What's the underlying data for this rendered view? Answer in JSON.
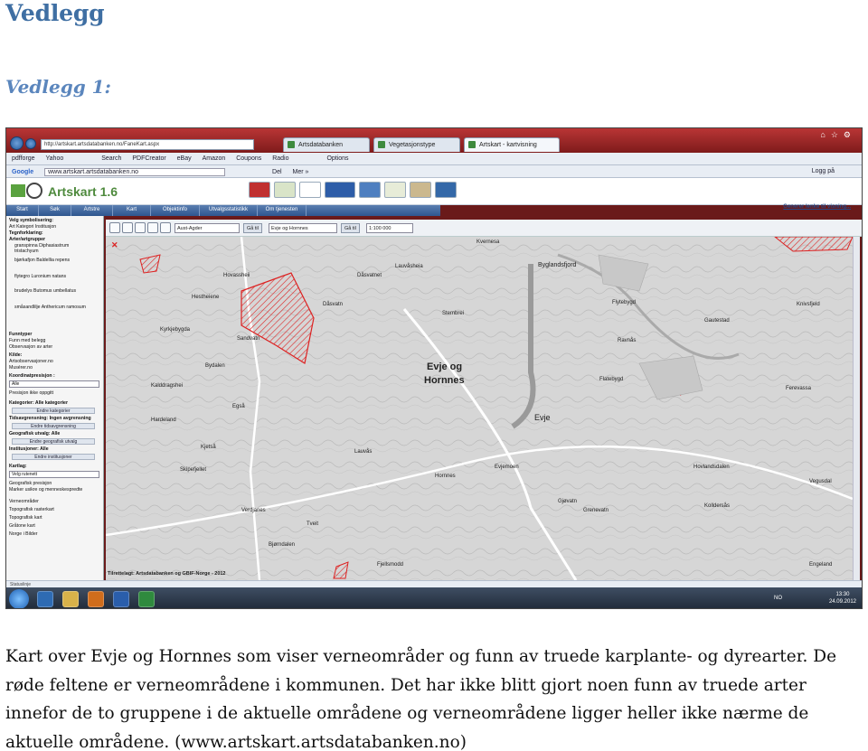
{
  "document": {
    "title": "Vedlegg",
    "subtitle": "Vedlegg 1:",
    "caption_lines": [
      "Kart over Evje og Hornnes som viser verneområder og funn av truede karplante- og dyrearter. De",
      "røde feltene er verneområdene i kommunen. Det har ikke blitt gjort noen funn av truede arter",
      "innefor de to gruppene i de aktuelle områdene og verneområdene ligger heller ikke nærme de",
      "aktuelle områdene. (www.artskart.artsdatabanken.no)"
    ]
  },
  "browser": {
    "address": "http://artskart.artsdatabanken.no/FaneKart.aspx",
    "tabs": [
      "Artsdatabanken",
      "Vegetasjonstype",
      "Artskart - kartvisning"
    ],
    "toolbar1": [
      "pdfforge",
      "Yahoo",
      "Search",
      "PDFCreator",
      "eBay",
      "Amazon",
      "Coupons",
      "Radio",
      "Options"
    ],
    "toolbar2_address": "www.artskart.artsdatabanken.no",
    "toolbar2_items": [
      "Google",
      "Del",
      "Mer »",
      "Logg på"
    ]
  },
  "app": {
    "title": "Artskart 1.6",
    "nav_tabs": [
      "Start",
      "Søk",
      "Artstre",
      "Kart",
      "Objektinfo",
      "Utvalgsstatistikk",
      "Om tjenesten"
    ],
    "generate_link": "Generer lenke til visning...",
    "map_selects": {
      "fylke": "Aust-Agder",
      "go1": "Gå til",
      "kommune": "Evje og Hornnes",
      "go2": "Gå til",
      "scale": "1:100 000"
    },
    "sidebar": {
      "lines": [
        "Velg symbolisering:",
        "Art  Kategori  Institusjon",
        "Tegnforklaring:",
        "Arter/artgrupper",
        "granspinna Diphasiastrum",
        "tristachyum",
        "bjørkafjon Baldellia repens",
        "flytegro Luronium natans",
        "brudelys Butomus umbellatus",
        "småsandlilje Anthericum ramosum",
        "Funntyper",
        "Funn med belegg",
        "Observasjon av arter",
        "Kilde:",
        "Artsobservasjoner.no",
        "Musérer.no",
        "Koordinatpresisjon :",
        "Alle",
        "Presisjon ikke oppgitt",
        "Kategorier: Alle kategorier",
        "Tidsavgrensning: Ingen avgrensning",
        "Geografisk utvalg: Alle",
        "Institusjoner: Alle",
        "Kartlag:",
        "Velg rutenett",
        "Geografisk presisjon",
        "Marker usikre og menneskespredte",
        "Verneområder",
        "Topografisk rasterkart",
        "Topografisk kart",
        "Gråtone kart",
        "Norge i Bilder"
      ],
      "buttons": [
        "Endre kategorier",
        "Endre tidsavgrensning",
        "Endre geografisk utvalg",
        "Endre institusjoner"
      ]
    },
    "map_labels": [
      "Evje og",
      "Hornnes",
      "Evje",
      "Hornnes",
      "Byglandsfjord",
      "Sandvatn",
      "Hovassheii",
      "Hestheiene",
      "Kyrkjebygda",
      "Bydalen",
      "Kalddragshei",
      "Egså",
      "Hardeland",
      "Kjetså",
      "Skipefjellet",
      "Verdjanes",
      "Bjørndalen",
      "Tveit",
      "Lauvås",
      "Flytebygd",
      "Ravnås",
      "Gautestad",
      "Flatebygd",
      "Hovlandsdalen",
      "Engeland",
      "Vegusdal",
      "Kolldersås",
      "Grenevatn",
      "Fjellsmodd",
      "Gjøvatn",
      "Stembrei",
      "Lauvåsheia",
      "Evjemoen",
      "Kvernesa",
      "Dåsvatn",
      "Dåsvatnet",
      "Knivsfjeld",
      "Ferevassa"
    ],
    "map_credit": "Tilrettelagt: Artsdatabanken og GBIF-Norge - 2012",
    "status": "Statuslinje"
  },
  "taskbar": {
    "time": "13:30",
    "date": "24.09.2012",
    "lang": "NO"
  }
}
